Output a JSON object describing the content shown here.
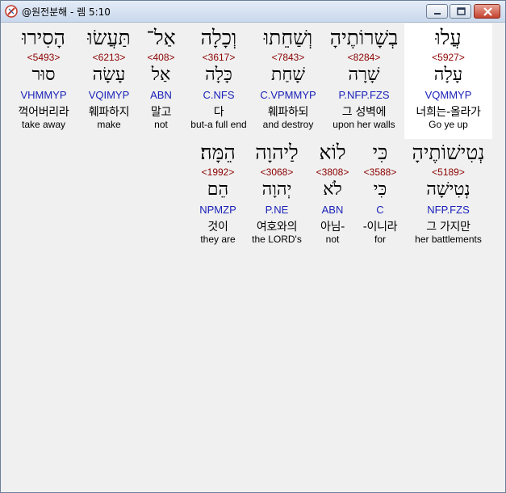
{
  "window": {
    "title": "@원전분해 - 렘 5:10"
  },
  "line1": [
    {
      "hebrew": "עֲלוּ",
      "strong": "<5927>",
      "lemma": "עָלָה",
      "morph": "VQMMYP",
      "korean": "너희는-올라가",
      "english": "Go ye up",
      "selected": true
    },
    {
      "hebrew": "בְשָׁרוֹתֶיהָ",
      "strong": "<8284>",
      "lemma": "שָׁרָה",
      "morph": "P.NFP.FZS",
      "korean": "그 성벽에",
      "english": "upon her walls"
    },
    {
      "hebrew": "וְשַׁחֵתוּ",
      "strong": "<7843>",
      "lemma": "שָׁחַת",
      "morph": "C.VPMMYP",
      "korean": "훼파하되",
      "english": "and destroy"
    },
    {
      "hebrew": "וְכָלָה",
      "strong": "<3617>",
      "lemma": "כָּלָה",
      "morph": "C.NFS",
      "korean": "다",
      "english": "but-a full end"
    },
    {
      "hebrew": "אַל־",
      "strong": "<408>",
      "lemma": "אַל",
      "morph": "ABN",
      "korean": "말고",
      "english": "not"
    },
    {
      "hebrew": "תַּעֲשׂוּ",
      "strong": "<6213>",
      "lemma": "עָשָׂה",
      "morph": "VQIMYP",
      "korean": "훼파하지",
      "english": "make"
    },
    {
      "hebrew": "הָסִירוּ",
      "strong": "<5493>",
      "lemma": "סוּר",
      "morph": "VHMMYP",
      "korean": "꺽어버리라",
      "english": "take away"
    }
  ],
  "line2": [
    {
      "hebrew": "נְטִישׁוֹתֶיהָ",
      "strong": "<5189>",
      "lemma": "נְטִישָׁה",
      "morph": "NFP.FZS",
      "korean": "그 가지만",
      "english": "her battlements"
    },
    {
      "hebrew": "כִּי",
      "strong": "<3588>",
      "lemma": "כִּי",
      "morph": "C",
      "korean": "-이니라",
      "english": "for"
    },
    {
      "hebrew": "לוֹא",
      "strong": "<3808>",
      "lemma": "לֹא",
      "morph": "ABN",
      "korean": "아님-",
      "english": "not"
    },
    {
      "hebrew": "לַיהוָה",
      "strong": "<3068>",
      "lemma": "יְהוָה",
      "morph": "P.NE",
      "korean": "여호와의",
      "english": "the LORD's"
    },
    {
      "hebrew": "הֵמָּה׃",
      "strong": "<1992>",
      "lemma": "הֵם",
      "morph": "NPMZP",
      "korean": "것이",
      "english": "they are"
    }
  ]
}
